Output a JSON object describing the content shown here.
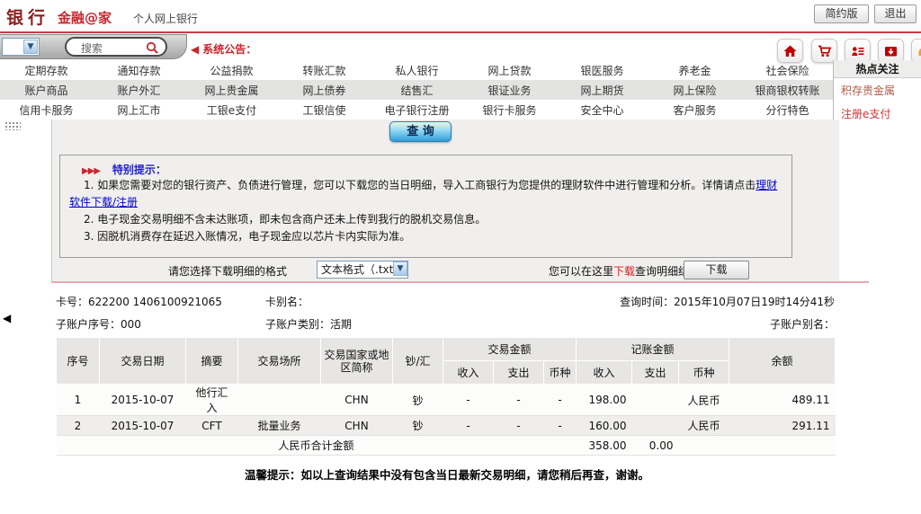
{
  "colors": {
    "accent_red": "#c9252d",
    "link_blue": "#0000cc",
    "pink_divider": "#e9a7b0",
    "query_button_blue": "#2f9fd8"
  },
  "header": {
    "brand_bank": "银行",
    "brand_home": "金融@家",
    "subtitle": "个人网上银行",
    "simple_version_button": "简约版",
    "logout_button": "退出"
  },
  "toolbar": {
    "search_placeholder": "搜索",
    "announcement_label": "系统公告：",
    "icons": [
      "home-icon",
      "shopping-cart-icon",
      "contacts-icon",
      "message-download-icon",
      "customer-service-icon"
    ]
  },
  "nav": {
    "row1": [
      "定期存款",
      "通知存款",
      "公益捐款",
      "转账汇款",
      "私人银行",
      "网上贷款",
      "银医服务",
      "养老金",
      "社会保险"
    ],
    "row2": [
      "账户商品",
      "账户外汇",
      "网上贵金属",
      "网上债券",
      "结售汇",
      "银证业务",
      "网上期货",
      "网上保险",
      "银商银权转账"
    ],
    "row3": [
      "信用卡服务",
      "网上汇市",
      "工银e支付",
      "工银信使",
      "电子银行注册",
      "银行卡服务",
      "安全中心",
      "客户服务",
      "分行特色"
    ]
  },
  "hot": {
    "title": "热点关注",
    "links": [
      "积存贵金属",
      "注册e支付"
    ]
  },
  "main": {
    "query_button": "查 询",
    "tips_arrows": "▶▶▶",
    "tips_title": "特别提示：",
    "tip1_prefix": "1. 如果您需要对您的银行资产、负债进行管理，您可以下载您的当日明细，导入工商银行为您提供的理财软件中进行管理和分析。详情请点击",
    "tip1_link": "理财软件下载/注册",
    "tip2": "2. 电子现金交易明细不含未达账项，即未包含商户还未上传到我行的脱机交易信息。",
    "tip3": "3. 因脱机消费存在延迟入账情况，电子现金应以芯片卡内实际为准。"
  },
  "download": {
    "format_label": "请您选择下载明细的格式",
    "format_value": "文本格式（.txt）",
    "hint_prefix": "您可以在这里",
    "hint_red": "下载",
    "hint_suffix": "查询明细结果",
    "download_button": "下载"
  },
  "account": {
    "card_label": "卡号：",
    "card_number": "622200 1406100921065",
    "card_alias_label": "卡别名：",
    "query_time_label": "查询时间：",
    "query_time": "2015年10月07日19时14分41秒",
    "sub_seq_label": "子账户序号：",
    "sub_seq": "000",
    "sub_type_label": "子账户类别：",
    "sub_type": "活期",
    "sub_alias_label": "子账户别名："
  },
  "table": {
    "h_seq": "序号",
    "h_date": "交易日期",
    "h_summary": "摘要",
    "h_place": "交易场所",
    "h_country": "交易国家或地区简称",
    "h_cash": "钞/汇",
    "h_trade_amount": "交易金额",
    "h_book_amount": "记账金额",
    "h_income": "收入",
    "h_expense": "支出",
    "h_currency": "币种",
    "h_balance": "余额",
    "rows": [
      [
        "1",
        "2015-10-07",
        "他行汇入",
        "",
        "CHN",
        "钞",
        "-",
        "-",
        "-",
        "198.00",
        "",
        "人民币",
        "489.11"
      ],
      [
        "2",
        "2015-10-07",
        "CFT",
        "批量业务",
        "CHN",
        "钞",
        "-",
        "-",
        "-",
        "160.00",
        "",
        "人民币",
        "291.11"
      ]
    ],
    "total_label": "人民币合计金额",
    "total_income": "358.00",
    "total_expense": "0.00"
  },
  "footer_note": "温馨提示：如以上查询结果中没有包含当日最新交易明细，请您稍后再查，谢谢。"
}
